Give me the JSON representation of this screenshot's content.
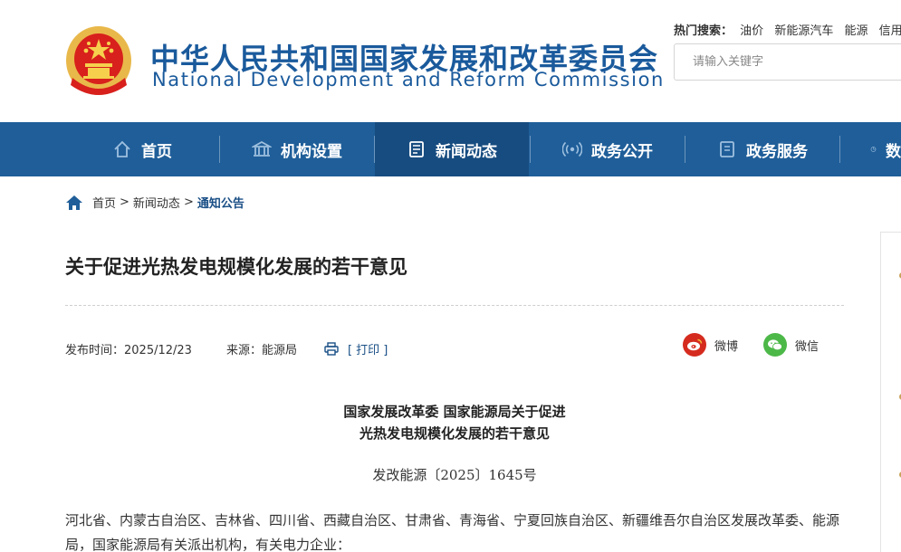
{
  "site": {
    "title_cn": "中华人民共和国国家发展和改革委员会",
    "title_en": "National Development and Reform Commission"
  },
  "hot_search": {
    "label": "热门搜索：",
    "keywords": [
      "油价",
      "新能源汽车",
      "能源",
      "信用信"
    ]
  },
  "search": {
    "placeholder": "请输入关键字"
  },
  "nav": {
    "items": [
      {
        "label": "首页",
        "icon": "home-icon"
      },
      {
        "label": "机构设置",
        "icon": "institution-icon"
      },
      {
        "label": "新闻动态",
        "icon": "news-icon"
      },
      {
        "label": "政务公开",
        "icon": "broadcast-icon"
      },
      {
        "label": "政务服务",
        "icon": "document-icon"
      },
      {
        "label": "数",
        "icon": "chart-icon"
      }
    ],
    "active_index": 2
  },
  "breadcrumb": {
    "items": [
      "首页",
      "新闻动态"
    ],
    "current": "通知公告",
    "separator": ">"
  },
  "article": {
    "title": "关于促进光热发电规模化发展的若干意见",
    "date_label": "发布时间：2025/12/23",
    "source_label": "来源：能源局",
    "print_label": "[ 打印 ]",
    "share": [
      {
        "label": "微博",
        "icon": "weibo-icon",
        "color": "#d52b1e"
      },
      {
        "label": "微信",
        "icon": "wechat-icon",
        "color": "#4cb848"
      }
    ],
    "doc_heading_line1": "国家发展改革委 国家能源局关于促进",
    "doc_heading_line2": "光热发电规模化发展的若干意见",
    "doc_number": "发改能源〔2025〕1645号",
    "paragraph": "河北省、内蒙古自治区、吉林省、四川省、西藏自治区、甘肃省、青海省、宁夏回族自治区、新疆维吾尔自治区发展改革委、能源局，国家能源局有关派出机构，有关电力企业："
  },
  "colors": {
    "brand_blue": "#1a5a9c",
    "nav_bg": "#1f5e99",
    "nav_active": "#174c80",
    "emblem_red": "#d8201c",
    "emblem_gold": "#e9b84a"
  }
}
